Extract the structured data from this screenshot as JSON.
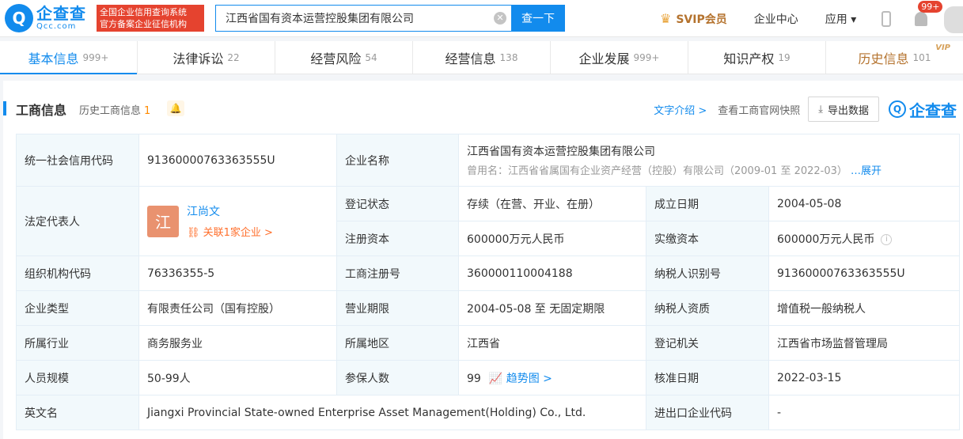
{
  "header": {
    "logo_cn": "企查查",
    "logo_en": "Qcc.com",
    "badge_line1": "全国企业信用查询系统",
    "badge_line2": "官方备案企业征信机构",
    "search_value": "江西省国有资本运营控股集团有限公司",
    "search_button": "查一下",
    "svip": "SVIP会员",
    "enterprise_center": "企业中心",
    "apps": "应用",
    "notifications": "99+"
  },
  "tabs": [
    {
      "label": "基本信息",
      "count": "999+"
    },
    {
      "label": "法律诉讼",
      "count": "22"
    },
    {
      "label": "经营风险",
      "count": "54"
    },
    {
      "label": "经营信息",
      "count": "138"
    },
    {
      "label": "企业发展",
      "count": "999+"
    },
    {
      "label": "知识产权",
      "count": "19"
    },
    {
      "label": "历史信息",
      "count": "101",
      "tag": "VIP"
    }
  ],
  "section": {
    "title": "工商信息",
    "history_label": "历史工商信息",
    "history_count": "1",
    "text_intro": "文字介绍 >",
    "snapshot": "查看工商官网快照",
    "export": "导出数据",
    "watermark": "企查查"
  },
  "info": {
    "uscc_label": "统一社会信用代码",
    "uscc": "91360000763363555U",
    "name_label": "企业名称",
    "name": "江西省国有资本运营控股集团有限公司",
    "former_name": "曾用名：江西省省属国有企业资产经营（控股）有限公司（2009-01 至 2022-03）",
    "expand": "…展开",
    "legal_rep_label": "法定代表人",
    "legal_rep_avatar": "江",
    "legal_rep": "江尚文",
    "legal_rep_link": "关联1家企业 >",
    "status_label": "登记状态",
    "status": "存续（在营、开业、在册）",
    "founded_label": "成立日期",
    "founded": "2004-05-08",
    "reg_capital_label": "注册资本",
    "reg_capital": "600000万元人民币",
    "paid_capital_label": "实缴资本",
    "paid_capital": "600000万元人民币",
    "org_code_label": "组织机构代码",
    "org_code": "76336355-5",
    "biz_reg_no_label": "工商注册号",
    "biz_reg_no": "360000110004188",
    "taxpayer_id_label": "纳税人识别号",
    "taxpayer_id": "91360000763363555U",
    "type_label": "企业类型",
    "type": "有限责任公司（国有控股）",
    "term_label": "营业期限",
    "term": "2004-05-08 至 无固定期限",
    "taxpayer_qual_label": "纳税人资质",
    "taxpayer_qual": "增值税一般纳税人",
    "industry_label": "所属行业",
    "industry": "商务服务业",
    "region_label": "所属地区",
    "region": "江西省",
    "authority_label": "登记机关",
    "authority": "江西省市场监督管理局",
    "staff_label": "人员规模",
    "staff": "50-99人",
    "insured_label": "参保人数",
    "insured": "99",
    "trend": "趋势图 >",
    "approved_label": "核准日期",
    "approved": "2022-03-15",
    "en_name_label": "英文名",
    "en_name": "Jiangxi Provincial State-owned Enterprise Asset Management(Holding) Co., Ltd.",
    "ie_code_label": "进出口企业代码",
    "ie_code": "-"
  }
}
